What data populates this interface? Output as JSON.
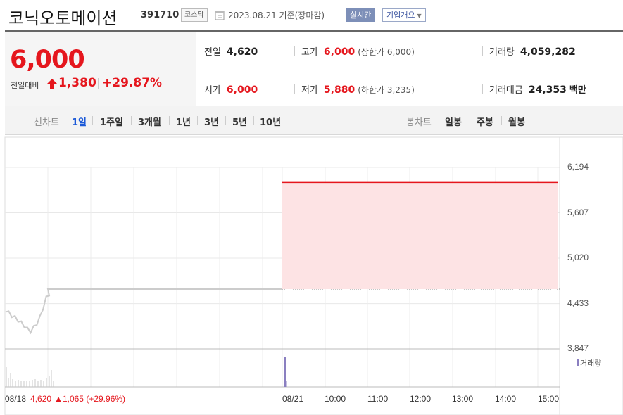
{
  "header": {
    "name": "코닉오토메이션",
    "code": "391710",
    "market": "코스닥",
    "date": "2023.08.21",
    "basis": "기준(장마감)",
    "realtime": "실시간",
    "overview": "기업개요"
  },
  "price": {
    "current": "6,000",
    "change_label": "전일대비",
    "change": "1,380",
    "change_pct": "+29.87%"
  },
  "stats": {
    "prev_close": {
      "label": "전일",
      "value": "4,620"
    },
    "open": {
      "label": "시가",
      "value": "6,000"
    },
    "high": {
      "label": "고가",
      "value": "6,000",
      "sub": "(상한가 6,000)"
    },
    "low": {
      "label": "저가",
      "value": "5,880",
      "sub": "(하한가 3,235)"
    },
    "volume": {
      "label": "거래량",
      "value": "4,059,282"
    },
    "trade_value": {
      "label": "거래대금",
      "value": "24,353",
      "unit": "백만"
    }
  },
  "period_bar": {
    "line_label": "선차트",
    "periods": [
      "1일",
      "1주일",
      "3개월",
      "1년",
      "3년",
      "5년",
      "10년"
    ],
    "selected": "1일",
    "candle_label": "봉차트",
    "candles": [
      "일봉",
      "주봉",
      "월봉"
    ]
  },
  "chart_data": {
    "type": "line",
    "y_ticks": [
      "6,194",
      "5,607",
      "5,020",
      "4,433",
      "3,847"
    ],
    "ylim": [
      3847,
      6194
    ],
    "x_ticks": [
      "08/18",
      "08/21",
      "10:00",
      "11:00",
      "12:00",
      "13:00",
      "14:00",
      "15:00"
    ],
    "prev_day": {
      "date": "08/18",
      "close": "4,620",
      "change": "1,065",
      "change_pct": "(+29.96%)"
    },
    "reference_price": 4620,
    "series": [
      {
        "name": "08/18",
        "values": [
          4350,
          4310,
          4280,
          4250,
          4220,
          4180,
          4150,
          4100,
          4080,
          4120,
          4180,
          4250,
          4380,
          4500,
          4560,
          4620,
          4620,
          4620,
          4620,
          4620,
          4620,
          4620,
          4620,
          4620,
          4620,
          4620,
          4620,
          4620,
          4620,
          4620
        ]
      },
      {
        "name": "08/21",
        "values": [
          6000,
          6000,
          6000,
          6000,
          6000,
          6000,
          6000,
          6000,
          6000,
          6000,
          6000,
          6000,
          6000,
          6000,
          6000,
          6000,
          6000,
          6000,
          6000,
          6000,
          6000,
          6000,
          6000,
          6000,
          6000,
          6000,
          6000,
          6000,
          6000,
          6000
        ]
      }
    ],
    "volume_label": "거래량",
    "colors": {
      "up": "#e5161d",
      "fill": "#fde3e4",
      "prev_line": "#cccccc",
      "volume": "#8a7fc0"
    }
  }
}
